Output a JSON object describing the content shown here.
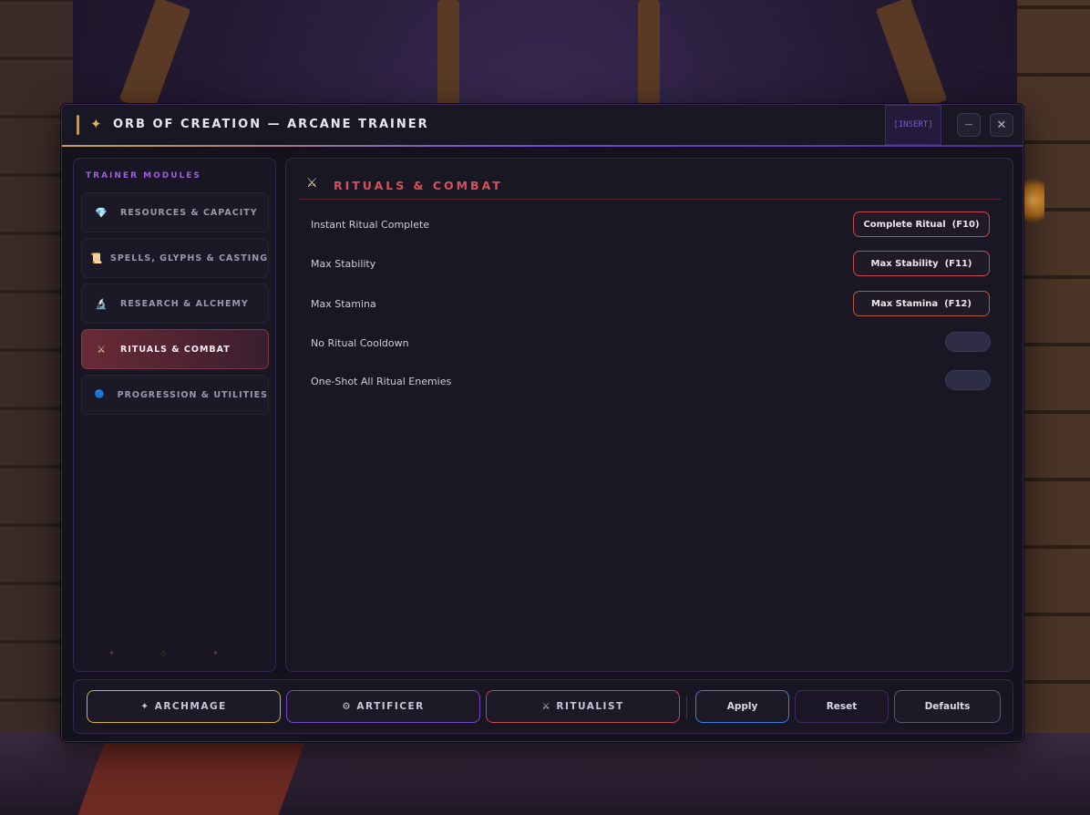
{
  "window": {
    "title_star": "✦",
    "title": "ORB OF CREATION  —  ARCANE TRAINER",
    "hotkey_badge": "[INSERT]",
    "minimize_glyph": "—",
    "close_glyph": "✕"
  },
  "sidebar": {
    "title": "TRAINER MODULES",
    "items": [
      {
        "icon": "💎",
        "icon_name": "gem-icon",
        "label": "RESOURCES & CAPACITY",
        "active": false
      },
      {
        "icon": "📜",
        "icon_name": "scroll-icon",
        "label": "SPELLS, GLYPHS & CASTING",
        "active": false
      },
      {
        "icon": "🔬",
        "icon_name": "microscope-icon",
        "label": "RESEARCH & ALCHEMY",
        "active": false
      },
      {
        "icon": "⚔",
        "icon_name": "crossed-swords-icon",
        "label": "RITUALS & COMBAT",
        "active": true
      },
      {
        "icon": "🔵",
        "icon_name": "orb-icon",
        "label": "PROGRESSION & UTILITIES",
        "active": false
      }
    ],
    "decoration": "✦ ◇ ✦"
  },
  "section": {
    "icon": "⚔",
    "icon_name": "crossed-swords-icon",
    "title": "RITUALS & COMBAT",
    "options": [
      {
        "label": "Instant Ritual Complete",
        "control": "button",
        "button_label": "Complete Ritual  (F10)"
      },
      {
        "label": "Max Stability",
        "control": "button",
        "button_label": "Max Stability  (F11)"
      },
      {
        "label": "Max Stamina",
        "control": "button",
        "button_label": "Max Stamina  (F12)"
      },
      {
        "label": "No Ritual Cooldown",
        "control": "toggle",
        "enabled": false
      },
      {
        "label": "One-Shot All Ritual Enemies",
        "control": "toggle",
        "enabled": false
      }
    ]
  },
  "footer": {
    "presets": [
      {
        "label": "✦ ARCHMAGE",
        "border_color": "#d6b048"
      },
      {
        "label": "⚙ ARTIFICER",
        "border_color": "#7a46c8"
      },
      {
        "label": "⚔ RITUALIST",
        "border_color": "#c9474f"
      }
    ],
    "apply_label": "Apply",
    "reset_label": "Reset",
    "defaults_label": "Defaults"
  },
  "colors": {
    "accent_gold": "#d6b048",
    "accent_purple": "#7a46c8",
    "accent_red": "#c9474f",
    "apply_blue": "#3b7ce0"
  }
}
